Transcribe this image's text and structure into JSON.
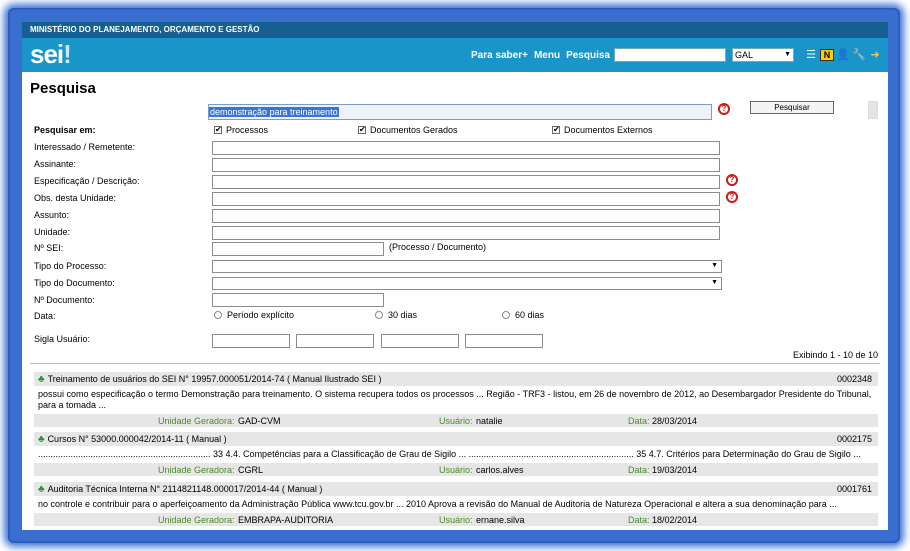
{
  "header": {
    "ministry": "MINISTÉRIO DO PLANEJAMENTO, ORÇAMENTO E GESTÃO",
    "logo": "sei",
    "logo_mark": "!",
    "nav": [
      "Para saber+",
      "Menu",
      "Pesquisa"
    ],
    "unit": "GAL",
    "icons": [
      "list-icon",
      "n-badge-icon",
      "user-icon",
      "wrench-icon",
      "exit-icon"
    ]
  },
  "page": {
    "title": "Pesquisa",
    "query": "demonstração para treinamento",
    "search_button": "Pesquisar",
    "help_glyph": "?"
  },
  "form": {
    "search_in_label": "Pesquisar em:",
    "checkboxes": [
      "Processos",
      "Documentos Gerados",
      "Documentos Externos"
    ],
    "check_mark": "✔",
    "fields": {
      "interessado": "Interessado / Remetente:",
      "assinante": "Assinante:",
      "especificacao": "Especificação / Descrição:",
      "obs": "Obs. desta Unidade:",
      "assunto": "Assunto:",
      "unidade": "Unidade:",
      "nsei": "Nº SEI:",
      "nsei_hint": "(Processo / Documento)",
      "tipo_processo": "Tipo do Processo:",
      "tipo_documento": "Tipo do Documento:",
      "ndocumento": "Nº Documento:",
      "data": "Data:",
      "sigla": "Sigla Usuário:"
    },
    "date_options": [
      "Período explícito",
      "30 dias",
      "60 dias"
    ]
  },
  "results": {
    "count": "Exibindo 1 - 10 de 10",
    "labels": {
      "unit": "Unidade Geradora:",
      "user": "Usuário:",
      "date": "Data:"
    },
    "items": [
      {
        "title": "Treinamento de usuários do SEI N° 19957.000051/2014-74 ( Manual Ilustrado SEI )",
        "number": "0002348",
        "snippet": "possui como especificação o termo Demonstração para treinamento. O sistema recupera todos os processos ...  Região - TRF3 - listou, em 26 de novembro de 2012, ao Desembargador Presidente do Tribunal, para a tomada ...",
        "unit": "GAD-CVM",
        "user": "natalie",
        "date": "28/03/2014"
      },
      {
        "title": "Cursos N° 53000.000042/2014-11 ( Manual )",
        "number": "0002175",
        "snippet": "..................................................................... 33 4.4. Competências para a Classificação de Grau de Sigilo ...  .................................................................. 35 4.7. Critérios para Determinação do Grau de Sigilo ...",
        "unit": "CGRL",
        "user": "carlos.alves",
        "date": "19/03/2014"
      },
      {
        "title": "Auditoria Técnica Interna N° 2114821148.000017/2014-44 ( Manual )",
        "number": "0001761",
        "snippet": "no controle e contribuir para o aperfeiçoamento da Administração Pública www.tcu.gov.br ...  2010 Aprova a revisão do Manual de Auditoria de Natureza Operacional e altera a sua denominação para ...",
        "unit": "EMBRAPA-AUDITORIA",
        "user": "ernane.silva",
        "date": "18/02/2014"
      }
    ]
  }
}
